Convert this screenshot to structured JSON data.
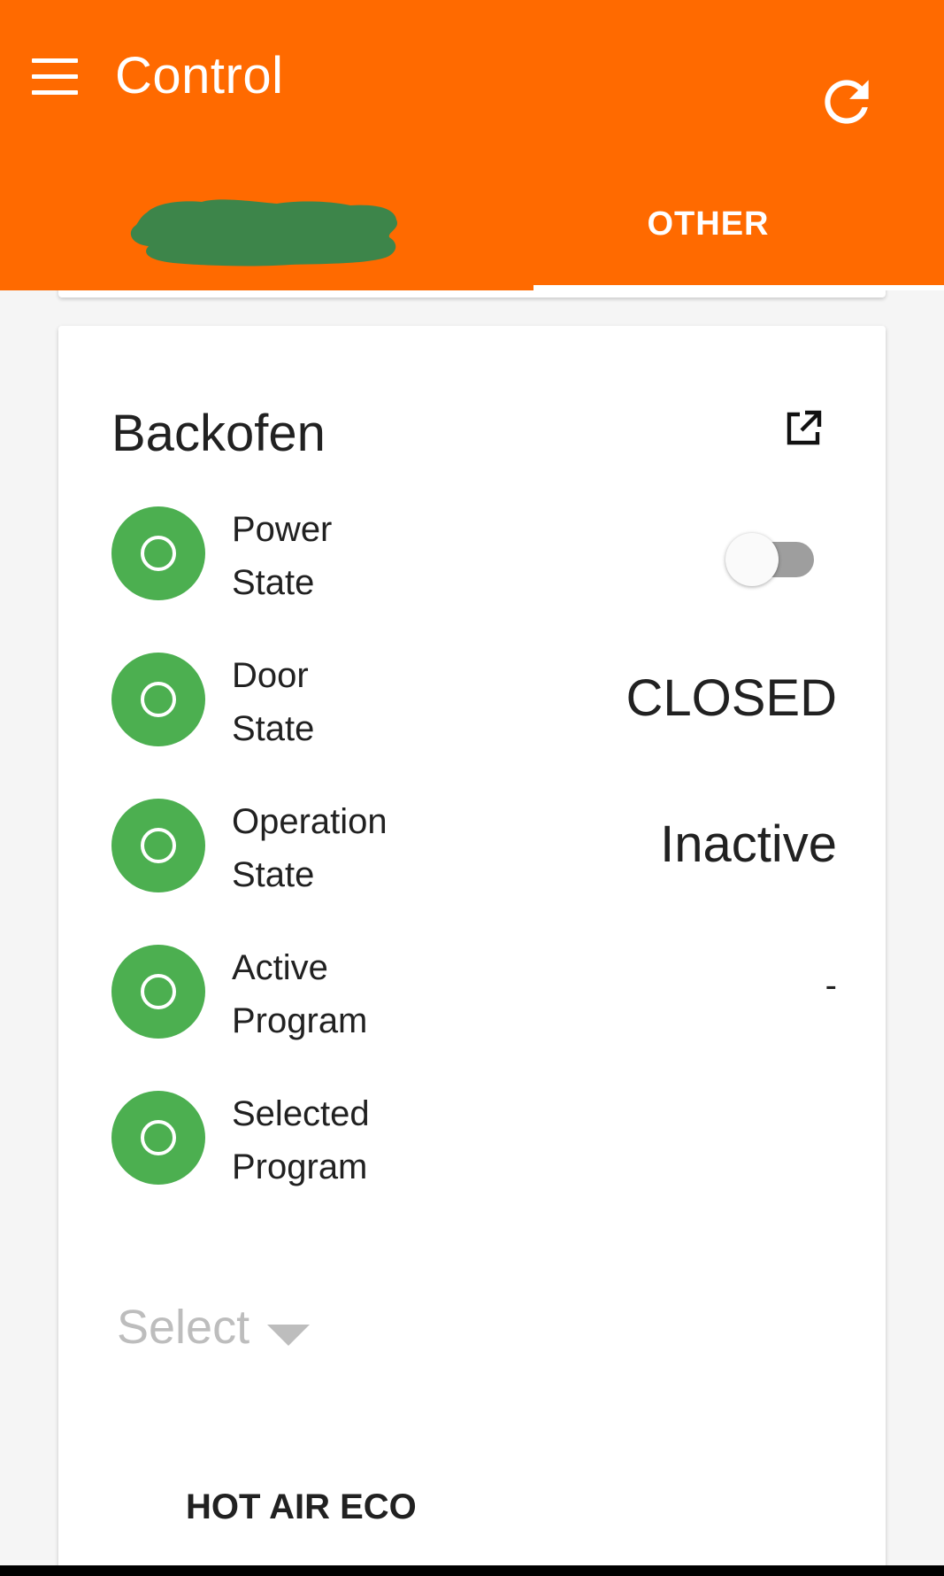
{
  "app": {
    "title": "Control",
    "accent_color": "#ff6a00",
    "menu_icon": "menu-icon",
    "refresh_icon": "refresh-icon"
  },
  "tabs": [
    {
      "label": "",
      "redacted": true
    },
    {
      "label": "OTHER",
      "selected": true
    }
  ],
  "card": {
    "title": "Backofen",
    "link_icon": "external-link-icon",
    "rows": [
      {
        "label_line1": "Power",
        "label_line2": "State",
        "value": "",
        "control": "toggle",
        "toggle_on": false
      },
      {
        "label_line1": "Door",
        "label_line2": "State",
        "value": "CLOSED"
      },
      {
        "label_line1": "Operation",
        "label_line2": "State",
        "value": "Inactive"
      },
      {
        "label_line1": "Active",
        "label_line2": "Program",
        "value": "-"
      },
      {
        "label_line1": "Selected",
        "label_line2": "Program",
        "value": ""
      }
    ],
    "status_color": "#4caf50",
    "select": {
      "placeholder": "Select"
    },
    "program_option": "HOT AIR ECO"
  }
}
